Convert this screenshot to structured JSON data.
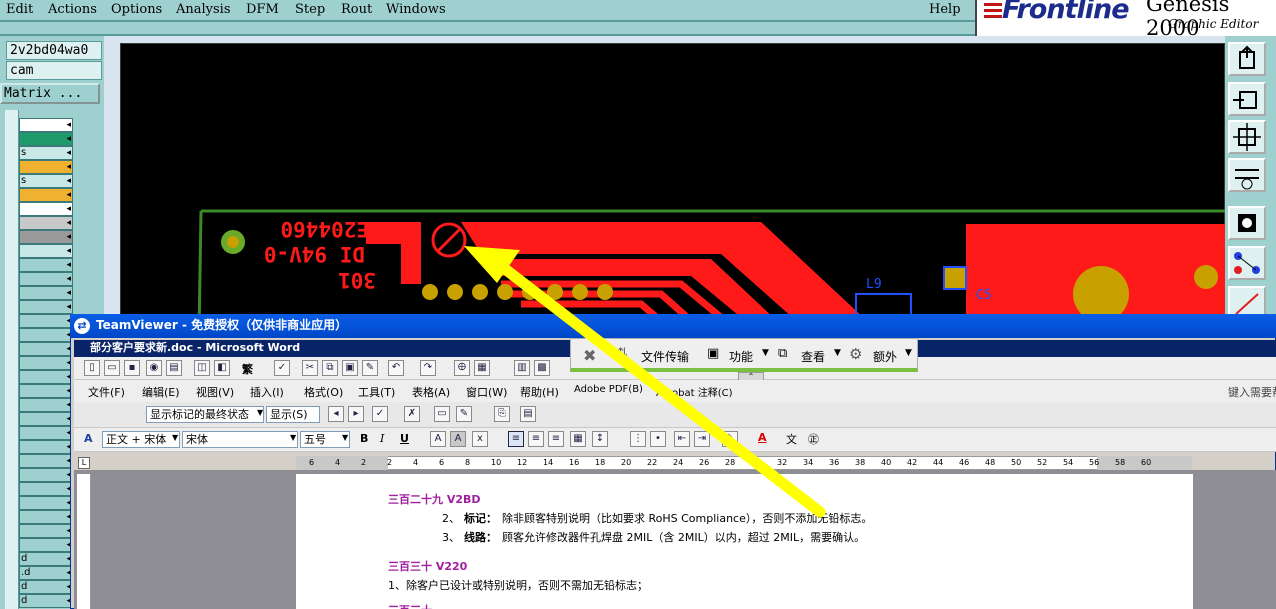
{
  "genesis": {
    "menu": [
      "Edit",
      "Actions",
      "Options",
      "Analysis",
      "DFM",
      "Step",
      "Rout",
      "Windows"
    ],
    "help": "Help",
    "logo": {
      "brand": "Frontline",
      "product": "Genesis 2000",
      "subtitle": "Graphic Editor"
    },
    "job_name": "2v2bd04wa0",
    "step_name": "cam",
    "matrix_button": "Matrix ...",
    "layer_rows": [
      "",
      "",
      "s",
      "",
      "s",
      "",
      "",
      "",
      "",
      "",
      "",
      "",
      "",
      "",
      "",
      "",
      "",
      "",
      "",
      "",
      "",
      "",
      "",
      "",
      "",
      "",
      "",
      "",
      "",
      "",
      "",
      "d",
      ".d",
      "d",
      "d"
    ],
    "board_text": {
      "part_no": "E204460",
      "rating": "DI 94V-0",
      "date_code": "301",
      "component_label": "L9",
      "component_label_2": "C5"
    }
  },
  "teamviewer": {
    "title": "TeamViewer - 免费授权（仅供非商业应用）",
    "toolbar": [
      "文件传输",
      "功能",
      "查看",
      "额外"
    ]
  },
  "word": {
    "title": "部分客户要求新.doc - Microsoft Word",
    "menu": [
      "文件(F)",
      "编辑(E)",
      "视图(V)",
      "插入(I)",
      "格式(O)",
      "工具(T)",
      "表格(A)",
      "窗口(W)",
      "帮助(H)",
      "Adobe PDF(B)",
      "Acrobat 注释(C)"
    ],
    "help_hint": "键入需要帮助的问题",
    "review": {
      "state": "显示标记的最终状态",
      "show": "显示(S)"
    },
    "format": {
      "style": "正文 + 宋体",
      "font": "宋体",
      "size": "五号"
    },
    "ruler_numbers": [
      "6",
      "4",
      "2",
      "2",
      "4",
      "6",
      "8",
      "10",
      "12",
      "14",
      "16",
      "18",
      "20",
      "22",
      "24",
      "26",
      "28",
      "30",
      "32",
      "34",
      "36",
      "38",
      "40",
      "42",
      "44",
      "46",
      "48",
      "50",
      "52",
      "54",
      "56",
      "58",
      "60"
    ],
    "doc": {
      "head1": "三百二十九 V2BD",
      "item2_label": "2、",
      "item2_bold": "标记：",
      "item2_text": "除非顾客特别说明（比如要求 RoHS Compliance），否则不添加无铅标志。",
      "item3_label": "3、",
      "item3_bold": "线路：",
      "item3_text": "顾客允许修改器件孔焊盘 2MIL（含 2MIL）以内，超过 2MIL，需要确认。",
      "head2": "三百三十 V220",
      "item1_text": "1、除客户已设计或特别说明，否则不需加无铅标志；",
      "head3": "三百三十一"
    }
  },
  "colors": {
    "copper": "#ff1a1a",
    "pad": "#c8a000",
    "outline": "#3a8a2a",
    "arrow": "#ffff00"
  }
}
